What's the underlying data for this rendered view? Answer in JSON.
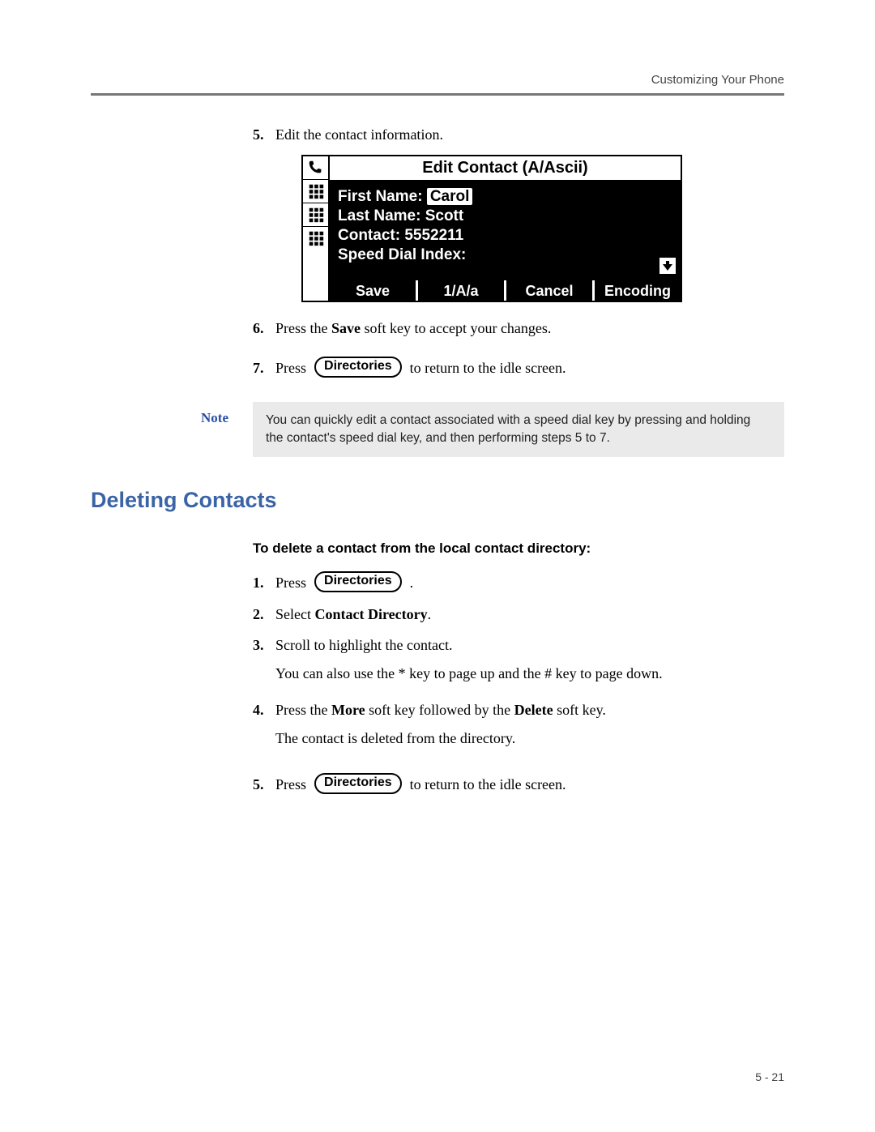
{
  "header": "Customizing Your Phone",
  "steps_a": {
    "s5": {
      "num": "5.",
      "text": "Edit the contact information."
    },
    "s6": {
      "num": "6.",
      "text_a": "Press the ",
      "text_b": "Save",
      "text_c": " soft key to accept your changes."
    },
    "s7": {
      "num": "7.",
      "text_a": "Press ",
      "btn": "Directories",
      "text_b": " to return to the idle screen."
    }
  },
  "phone": {
    "title": "Edit Contact (A/Ascii)",
    "first_label": "First Name:",
    "first_value": "Carol",
    "last": "Last Name: Scott",
    "contact": "Contact: 5552211",
    "speed": "Speed Dial Index:",
    "softkeys": {
      "k1": "Save",
      "k2": "1/A/a",
      "k3": "Cancel",
      "k4": "Encoding"
    }
  },
  "note": {
    "label": "Note",
    "text": "You can quickly edit a contact associated with a speed dial key by pressing and holding the contact's speed dial key, and then performing steps 5 to 7."
  },
  "section_heading": "Deleting Contacts",
  "subheading": "To delete a contact from the local contact directory:",
  "steps_b": {
    "s1": {
      "num": "1.",
      "text_a": "Press ",
      "btn": "Directories",
      "text_b": " ."
    },
    "s2": {
      "num": "2.",
      "text_a": "Select ",
      "text_b": "Contact Directory",
      "text_c": "."
    },
    "s3": {
      "num": "3.",
      "line1": "Scroll to highlight the contact.",
      "line2": "You can also use the * key to page up and the # key to page down."
    },
    "s4": {
      "num": "4.",
      "line1_a": "Press the ",
      "line1_b": "More",
      "line1_c": " soft key followed by the ",
      "line1_d": "Delete",
      "line1_e": " soft key.",
      "line2": "The contact is deleted from the directory."
    },
    "s5": {
      "num": "5.",
      "text_a": "Press ",
      "btn": "Directories",
      "text_b": " to return to the idle screen."
    }
  },
  "page_number": "5 - 21"
}
